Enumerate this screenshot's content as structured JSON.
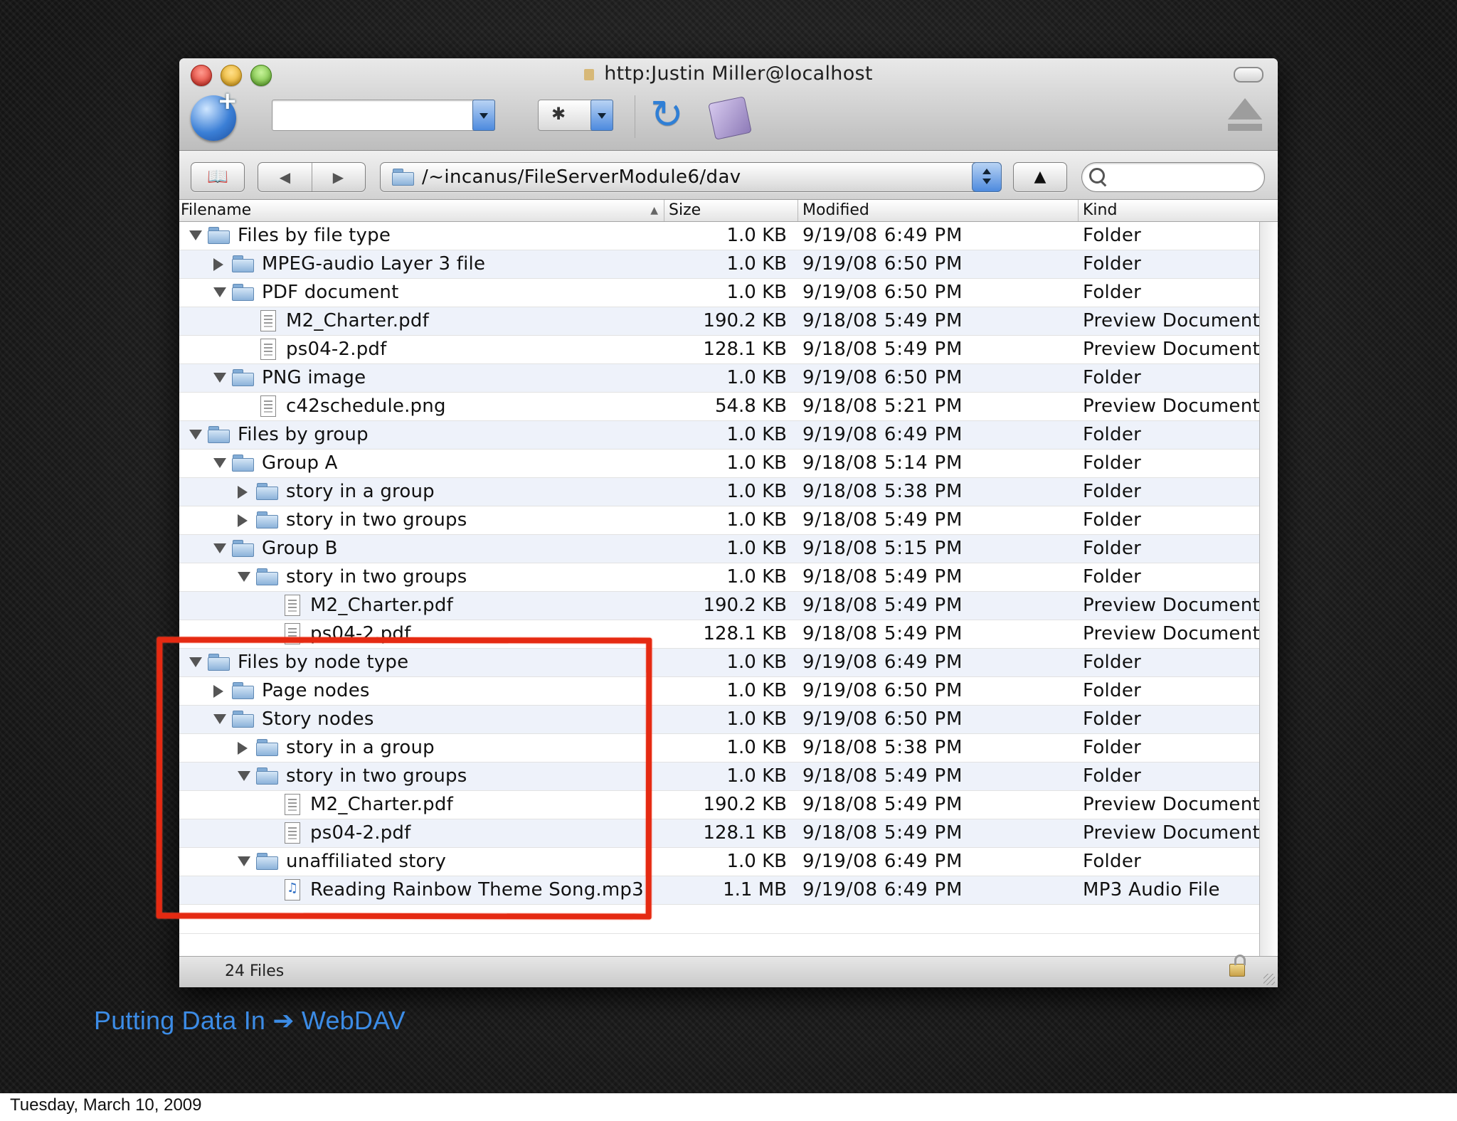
{
  "window": {
    "title": "http:Justin Miller@localhost",
    "path": "/~incanus/FileServerModule6/dav",
    "search_value": "",
    "address_value": ""
  },
  "toolbar": {
    "connect_icon": "globe-plus-icon",
    "action_icon": "gear-icon",
    "refresh_icon": "refresh-icon",
    "editor_icon": "editor-icon",
    "eject_icon": "eject-icon",
    "action_glyph": "✱",
    "refresh_glyph": "↻"
  },
  "pathbar": {
    "bookmarks_glyph": "📖",
    "back_glyph": "◀",
    "forward_glyph": "▶",
    "up_glyph": "▲"
  },
  "columns": {
    "filename": "Filename",
    "size": "Size",
    "modified": "Modified",
    "kind": "Kind",
    "sort_glyph": "▲"
  },
  "files": [
    {
      "name": "Files by file type",
      "depth": 0,
      "type": "folder",
      "disclosure": "open",
      "size": "1.0 KB",
      "modified": "9/19/08 6:49  PM",
      "kind": "Folder"
    },
    {
      "name": "MPEG-audio Layer 3 file",
      "depth": 1,
      "type": "folder",
      "disclosure": "closed",
      "size": "1.0 KB",
      "modified": "9/19/08 6:50  PM",
      "kind": "Folder"
    },
    {
      "name": "PDF document",
      "depth": 1,
      "type": "folder",
      "disclosure": "open",
      "size": "1.0 KB",
      "modified": "9/19/08 6:50  PM",
      "kind": "Folder"
    },
    {
      "name": "M2_Charter.pdf",
      "depth": 2,
      "type": "document",
      "disclosure": "none",
      "size": "190.2 KB",
      "modified": "9/18/08 5:49  PM",
      "kind": "Preview Document"
    },
    {
      "name": "ps04-2.pdf",
      "depth": 2,
      "type": "document",
      "disclosure": "none",
      "size": "128.1 KB",
      "modified": "9/18/08 5:49  PM",
      "kind": "Preview Document"
    },
    {
      "name": "PNG image",
      "depth": 1,
      "type": "folder",
      "disclosure": "open",
      "size": "1.0 KB",
      "modified": "9/19/08 6:50  PM",
      "kind": "Folder"
    },
    {
      "name": "c42schedule.png",
      "depth": 2,
      "type": "document",
      "disclosure": "none",
      "size": "54.8 KB",
      "modified": "9/18/08 5:21  PM",
      "kind": "Preview Document"
    },
    {
      "name": "Files by group",
      "depth": 0,
      "type": "folder",
      "disclosure": "open",
      "size": "1.0 KB",
      "modified": "9/19/08 6:49  PM",
      "kind": "Folder"
    },
    {
      "name": "Group A",
      "depth": 1,
      "type": "folder",
      "disclosure": "open",
      "size": "1.0 KB",
      "modified": "9/18/08 5:14  PM",
      "kind": "Folder"
    },
    {
      "name": "story in a group",
      "depth": 2,
      "type": "folder",
      "disclosure": "closed",
      "size": "1.0 KB",
      "modified": "9/18/08 5:38  PM",
      "kind": "Folder"
    },
    {
      "name": "story in two groups",
      "depth": 2,
      "type": "folder",
      "disclosure": "closed",
      "size": "1.0 KB",
      "modified": "9/18/08 5:49  PM",
      "kind": "Folder"
    },
    {
      "name": "Group B",
      "depth": 1,
      "type": "folder",
      "disclosure": "open",
      "size": "1.0 KB",
      "modified": "9/18/08 5:15  PM",
      "kind": "Folder"
    },
    {
      "name": "story in two groups",
      "depth": 2,
      "type": "folder",
      "disclosure": "open",
      "size": "1.0 KB",
      "modified": "9/18/08 5:49  PM",
      "kind": "Folder"
    },
    {
      "name": "M2_Charter.pdf",
      "depth": 3,
      "type": "document",
      "disclosure": "none",
      "size": "190.2 KB",
      "modified": "9/18/08 5:49  PM",
      "kind": "Preview Document"
    },
    {
      "name": "ps04-2.pdf",
      "depth": 3,
      "type": "document",
      "disclosure": "none",
      "size": "128.1 KB",
      "modified": "9/18/08 5:49  PM",
      "kind": "Preview Document"
    },
    {
      "name": "Files by node type",
      "depth": 0,
      "type": "folder",
      "disclosure": "open",
      "size": "1.0 KB",
      "modified": "9/19/08 6:49  PM",
      "kind": "Folder"
    },
    {
      "name": "Page nodes",
      "depth": 1,
      "type": "folder",
      "disclosure": "closed",
      "size": "1.0 KB",
      "modified": "9/19/08 6:50  PM",
      "kind": "Folder"
    },
    {
      "name": "Story nodes",
      "depth": 1,
      "type": "folder",
      "disclosure": "open",
      "size": "1.0 KB",
      "modified": "9/19/08 6:50  PM",
      "kind": "Folder"
    },
    {
      "name": "story in a group",
      "depth": 2,
      "type": "folder",
      "disclosure": "closed",
      "size": "1.0 KB",
      "modified": "9/18/08 5:38  PM",
      "kind": "Folder"
    },
    {
      "name": "story in two groups",
      "depth": 2,
      "type": "folder",
      "disclosure": "open",
      "size": "1.0 KB",
      "modified": "9/18/08 5:49  PM",
      "kind": "Folder"
    },
    {
      "name": "M2_Charter.pdf",
      "depth": 3,
      "type": "document",
      "disclosure": "none",
      "size": "190.2 KB",
      "modified": "9/18/08 5:49  PM",
      "kind": "Preview Document"
    },
    {
      "name": "ps04-2.pdf",
      "depth": 3,
      "type": "document",
      "disclosure": "none",
      "size": "128.1 KB",
      "modified": "9/18/08 5:49  PM",
      "kind": "Preview Document"
    },
    {
      "name": "unaffiliated story",
      "depth": 2,
      "type": "folder",
      "disclosure": "open",
      "size": "1.0 KB",
      "modified": "9/19/08 6:49  PM",
      "kind": "Folder"
    },
    {
      "name": "Reading Rainbow Theme Song.mp3",
      "depth": 3,
      "type": "audio",
      "disclosure": "none",
      "size": "1.1 MB",
      "modified": "9/19/08 6:49  PM",
      "kind": "MP3 Audio File"
    }
  ],
  "status": {
    "count": "24 Files"
  },
  "slide": {
    "caption": "Putting Data In ➔ WebDAV",
    "footer": "Tuesday, March 10, 2009",
    "highlight_color": "#e52a12",
    "caption_color": "#3c8ce6"
  }
}
